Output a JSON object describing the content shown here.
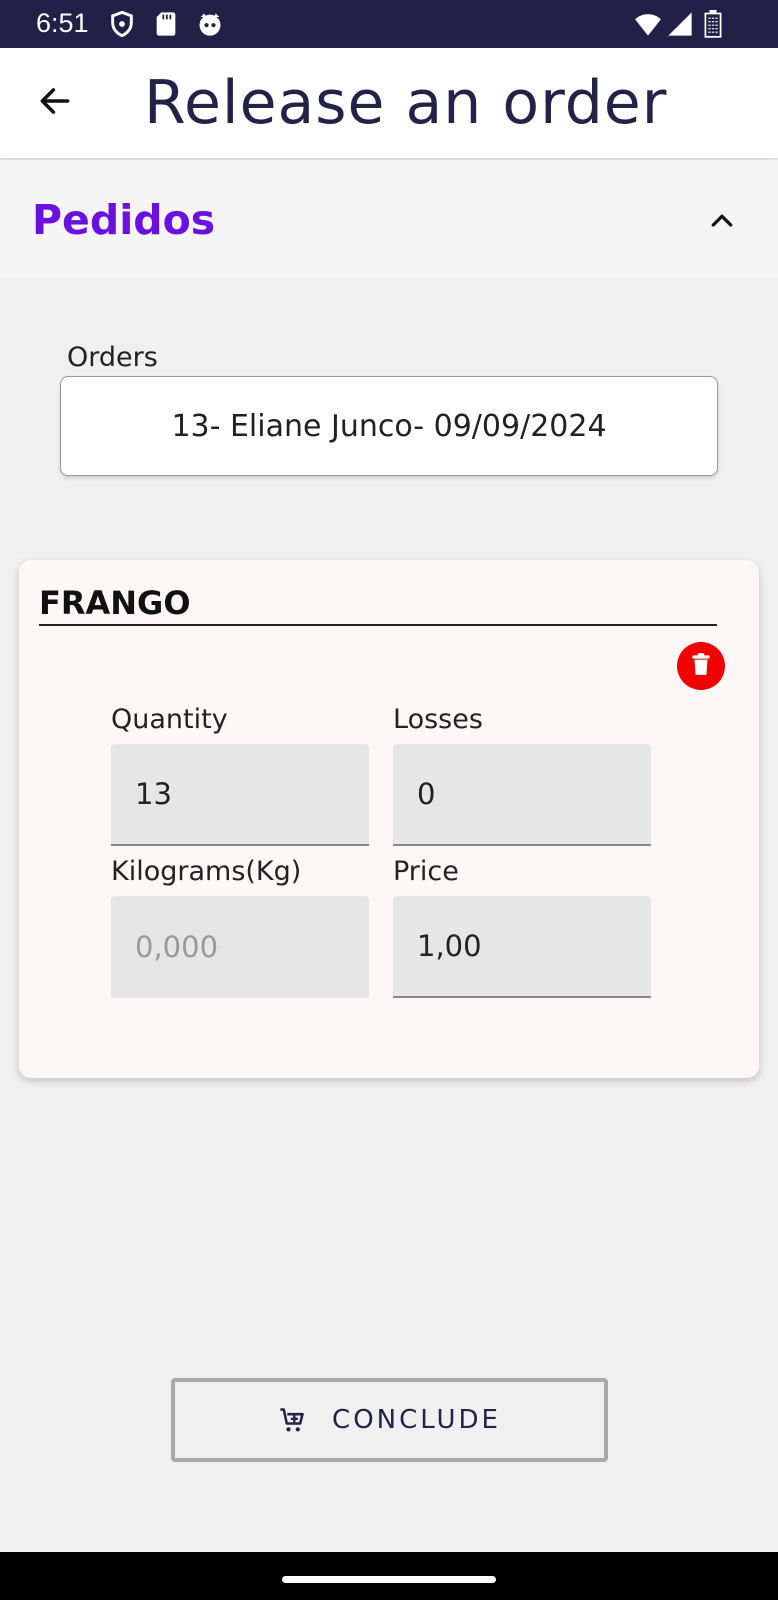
{
  "status_bar": {
    "time": "6:51",
    "left_icons": [
      "shield-icon",
      "sd-card-icon",
      "cat-face-icon"
    ],
    "right_icons": [
      "wifi-icon",
      "signal-icon",
      "battery-icon"
    ]
  },
  "app_bar": {
    "title": "Release an order",
    "back_icon": "arrow-left-icon"
  },
  "section": {
    "title": "Pedidos",
    "title_color": "#6a10e0",
    "toggle_icon": "chevron-up-icon"
  },
  "orders": {
    "label": "Orders",
    "selected": "13- Eliane Junco- 09/09/2024"
  },
  "item": {
    "name": "FRANGO",
    "delete_icon": "trash-icon",
    "delete_color": "#f00000",
    "quantity_label": "Quantity",
    "quantity_value": "13",
    "losses_label": "Losses",
    "losses_value": "0",
    "kilograms_label": "Kilograms(Kg)",
    "kilograms_placeholder": "0,000",
    "price_label": "Price",
    "price_value": "1,00"
  },
  "actions": {
    "conclude_label": "CONCLUDE",
    "conclude_icon": "cart-icon"
  }
}
